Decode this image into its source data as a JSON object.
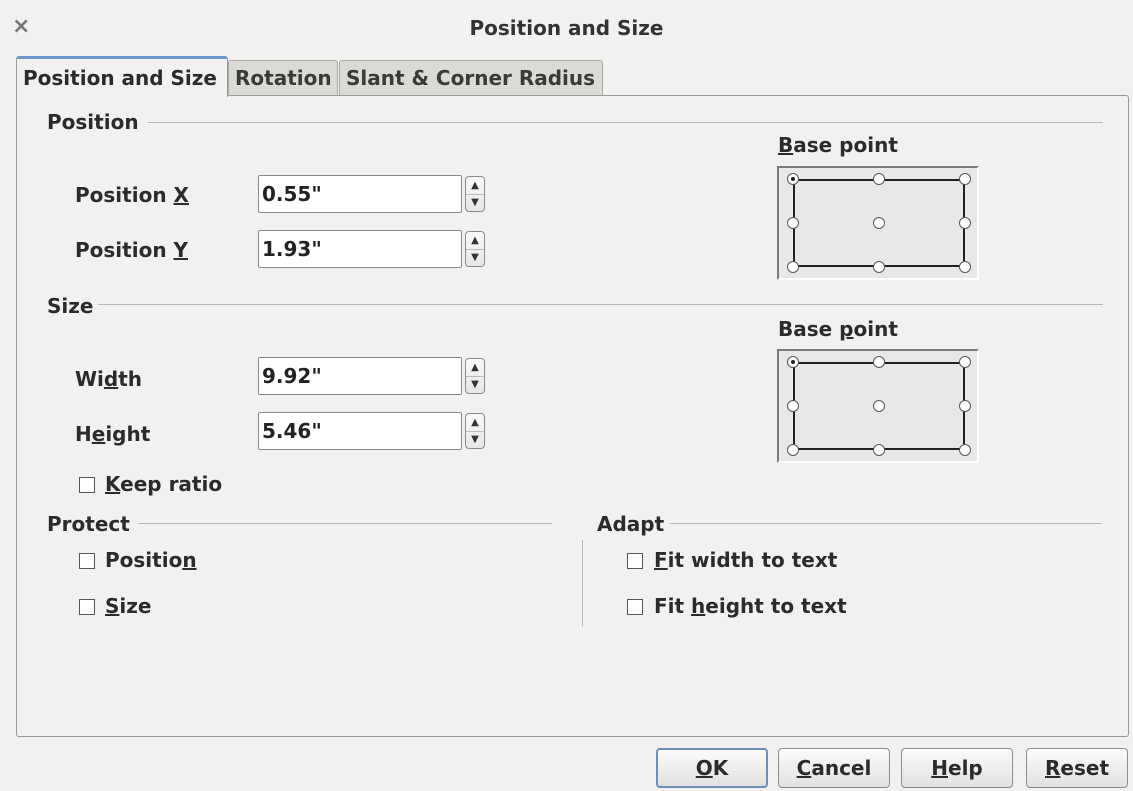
{
  "window": {
    "title": "Position and Size",
    "close_icon": "×"
  },
  "tabs": [
    {
      "label": "Position and Size",
      "active": true
    },
    {
      "label": "Rotation",
      "active": false
    },
    {
      "label": "Slant & Corner Radius",
      "active": false
    }
  ],
  "position": {
    "section_label": "Position",
    "x": {
      "pre": "Position ",
      "mnemonic": "X",
      "post": "",
      "value": "0.55\""
    },
    "y": {
      "pre": "Position ",
      "mnemonic": "Y",
      "post": "",
      "value": "1.93\""
    },
    "base_point": {
      "pre": "",
      "mnemonic": "B",
      "post": "ase point",
      "selected": "top-left"
    }
  },
  "size": {
    "section_label": "Size",
    "width": {
      "pre": "Wi",
      "mnemonic": "d",
      "post": "th",
      "value": "9.92\""
    },
    "height": {
      "pre": "H",
      "mnemonic": "e",
      "post": "ight",
      "value": "5.46\""
    },
    "keep_ratio": {
      "pre": "",
      "mnemonic": "K",
      "post": "eep ratio",
      "checked": false
    },
    "base_point": {
      "pre": "Base ",
      "mnemonic": "p",
      "post": "oint",
      "selected": "top-left"
    }
  },
  "protect": {
    "section_label": "Protect",
    "position": {
      "pre": "Positio",
      "mnemonic": "n",
      "post": "",
      "checked": false
    },
    "size": {
      "pre": "",
      "mnemonic": "S",
      "post": "ize",
      "checked": false
    }
  },
  "adapt": {
    "section_label": "Adapt",
    "fit_width": {
      "pre": "",
      "mnemonic": "F",
      "post": "it width to text",
      "checked": false
    },
    "fit_height": {
      "pre": "Fit ",
      "mnemonic": "h",
      "post": "eight to text",
      "checked": false
    }
  },
  "buttons": {
    "ok": {
      "pre": "",
      "mnemonic": "O",
      "post": "K"
    },
    "cancel": {
      "pre": "",
      "mnemonic": "C",
      "post": "ancel"
    },
    "help": {
      "pre": "",
      "mnemonic": "H",
      "post": "elp"
    },
    "reset": {
      "pre": "",
      "mnemonic": "R",
      "post": "eset"
    }
  },
  "icons": {
    "spin_up": "▲",
    "spin_down": "▼"
  }
}
